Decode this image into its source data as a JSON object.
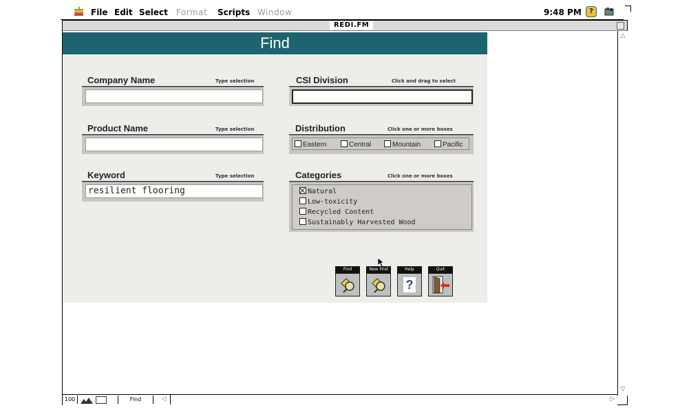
{
  "menubar": {
    "items": [
      {
        "label": "File",
        "enabled": true
      },
      {
        "label": "Edit",
        "enabled": true
      },
      {
        "label": "Select",
        "enabled": true
      },
      {
        "label": "Format",
        "enabled": false
      },
      {
        "label": "Scripts",
        "enabled": true
      },
      {
        "label": "Window",
        "enabled": false
      }
    ],
    "clock": "9:48 PM",
    "apple_icon": "apple-icon",
    "help_icon": "help-balloon-icon",
    "app_icon": "filemaker-app-icon"
  },
  "window": {
    "title": "REDI.FM"
  },
  "layout": {
    "header_title": "Find",
    "header_color": "#1e6470",
    "fields": {
      "company_name": {
        "label": "Company Name",
        "hint": "Type selection",
        "value": ""
      },
      "csi_division": {
        "label": "CSI Division",
        "hint": "Click and drag to select",
        "value": ""
      },
      "product_name": {
        "label": "Product Name",
        "hint": "Type selection",
        "value": ""
      },
      "distribution": {
        "label": "Distribution",
        "hint": "Click one or more boxes",
        "options": [
          {
            "label": "Eastern",
            "checked": false
          },
          {
            "label": "Central",
            "checked": false
          },
          {
            "label": "Mountain",
            "checked": false
          },
          {
            "label": "Pacific",
            "checked": false
          }
        ]
      },
      "keyword": {
        "label": "Keyword",
        "hint": "Type selection",
        "value": "resilient flooring"
      },
      "categories": {
        "label": "Categories",
        "hint": "Click one or more boxes",
        "options": [
          {
            "label": "Natural",
            "checked": true
          },
          {
            "label": "Low-toxicity",
            "checked": false
          },
          {
            "label": "Recycled Content",
            "checked": false
          },
          {
            "label": "Sustainably Harvested Wood",
            "checked": false
          }
        ]
      }
    },
    "buttons": [
      {
        "label": "Find",
        "icon": "find-magnifier-icon"
      },
      {
        "label": "New Find",
        "icon": "new-find-magnifier-icon"
      },
      {
        "label": "Help",
        "icon": "question-mark-icon"
      },
      {
        "label": "Quit",
        "icon": "exit-door-icon"
      }
    ]
  },
  "statusbar": {
    "zoom": "100",
    "mode": "Find"
  }
}
